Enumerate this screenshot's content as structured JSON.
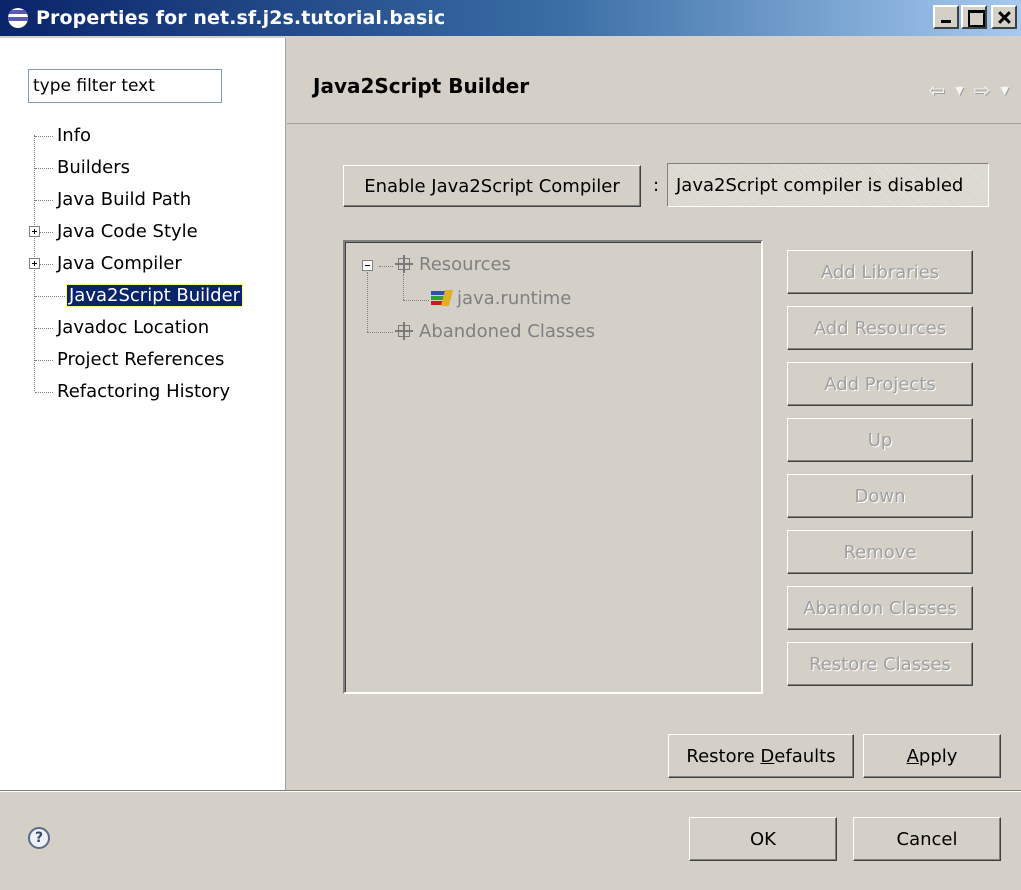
{
  "window": {
    "title": "Properties for net.sf.j2s.tutorial.basic"
  },
  "left_pane": {
    "filter_value": "type filter text",
    "tree": [
      {
        "label": "Info"
      },
      {
        "label": "Builders"
      },
      {
        "label": "Java Build Path"
      },
      {
        "label": "Java Code Style",
        "expandable": true
      },
      {
        "label": "Java Compiler",
        "expandable": true
      },
      {
        "label": "Java2Script Builder",
        "selected": true
      },
      {
        "label": "Javadoc Location"
      },
      {
        "label": "Project References"
      },
      {
        "label": "Refactoring History"
      }
    ]
  },
  "page": {
    "title": "Java2Script Builder",
    "enable_button": "Enable Java2Script Compiler",
    "separator": ":",
    "status_text": "Java2Script compiler is disabled",
    "resource_tree": {
      "resources": "Resources",
      "runtime": "java.runtime",
      "abandoned": "Abandoned Classes"
    },
    "side_buttons": {
      "add_libraries": "Add Libraries",
      "add_resources": "Add Resources",
      "add_projects": "Add Projects",
      "up": "Up",
      "down": "Down",
      "remove": "Remove",
      "abandon_classes": "Abandon Classes",
      "restore_classes": "Restore Classes"
    },
    "restore_defaults_pre": "Restore ",
    "restore_defaults_mnemonic": "D",
    "restore_defaults_post": "efaults",
    "apply_mnemonic": "A",
    "apply_post": "pply"
  },
  "footer": {
    "help_glyph": "?",
    "ok": "OK",
    "cancel": "Cancel"
  },
  "icons": {
    "title": "eclipse-icon",
    "help": "help-icon",
    "back": "back-arrow-icon",
    "forward": "forward-arrow-icon"
  },
  "colors": {
    "titlebar_start": "#0a246a",
    "titlebar_end": "#a6caf0",
    "selection": "#0a246a",
    "dialog_bg": "#d4d0c8"
  }
}
